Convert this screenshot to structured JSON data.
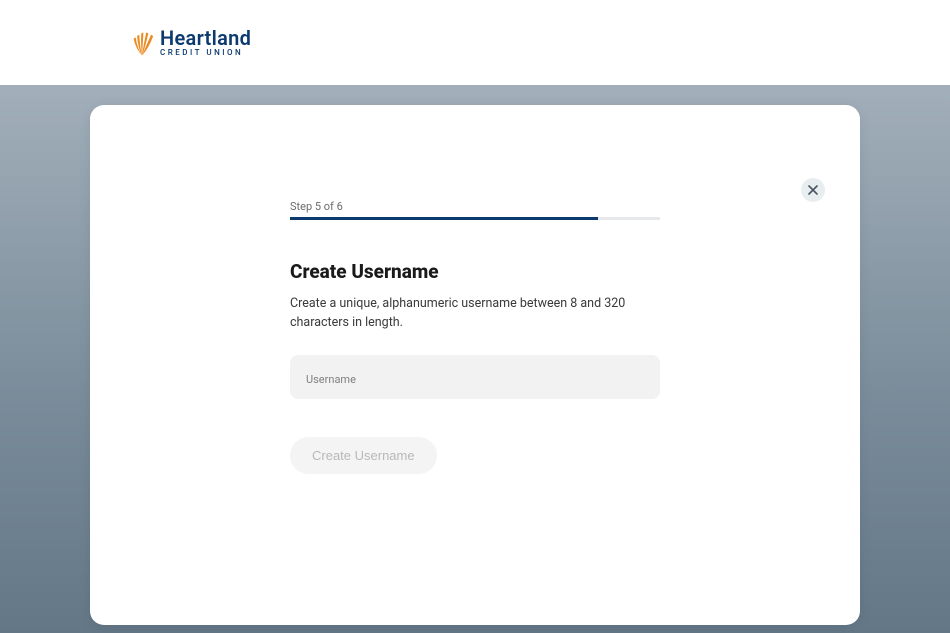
{
  "brand": {
    "name": "Heartland",
    "tagline": "CREDIT UNION"
  },
  "wizard": {
    "step_label": "Step 5 of 6",
    "title": "Create Username",
    "description": "Create a unique, alphanumeric username between 8 and 320 characters in length.",
    "field_label": "Username",
    "field_value": "",
    "submit_label": "Create Username"
  }
}
